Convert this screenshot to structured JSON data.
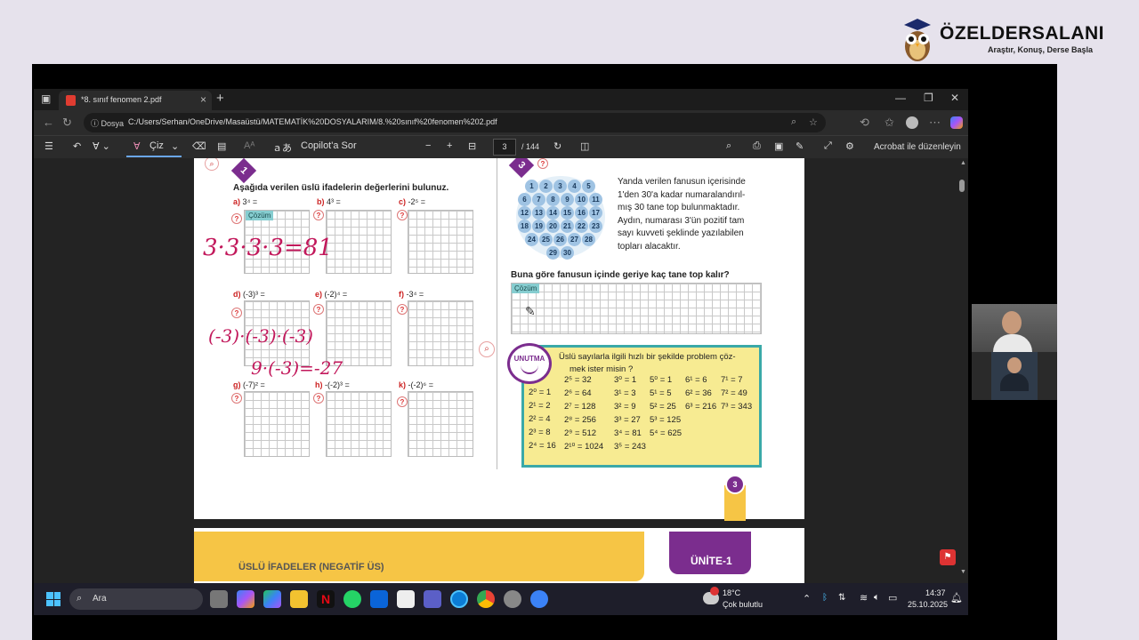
{
  "brand": {
    "name": "ÖZELDERSALANI",
    "tagline": "Araştır, Konuş, Derse Başla"
  },
  "browser": {
    "tab_title": "*8. sınıf fenomen 2.pdf",
    "url_prefix": "Dosya",
    "url": "C:/Users/Serhan/OneDrive/Masaüstü/MATEMATİK%20DOSYALARIM/8.%20sınıf%20fenomen%202.pdf"
  },
  "pdf_toolbar": {
    "draw_label": "Çiz",
    "copilot_label": "Copilot'a Sor",
    "page_current": "3",
    "page_total": "/ 144",
    "acrobat_label": "Acrobat ile düzenleyin"
  },
  "left": {
    "badge": "1",
    "heading": "Aşağıda verilen üslü ifadelerin değerlerini bulunuz.",
    "cozum": "Çözüm",
    "items": [
      {
        "label": "a)",
        "expr": "3⁴ ="
      },
      {
        "label": "b)",
        "expr": "4³ ="
      },
      {
        "label": "c)",
        "expr": "-2⁵ ="
      },
      {
        "label": "d)",
        "expr": "(-3)³ ="
      },
      {
        "label": "e)",
        "expr": "(-2)⁴ ="
      },
      {
        "label": "f)",
        "expr": "-3⁴ ="
      },
      {
        "label": "g)",
        "expr": "(-7)² ="
      },
      {
        "label": "h)",
        "expr": "-(-2)³ ="
      },
      {
        "label": "k)",
        "expr": "-(-2)⁶ ="
      }
    ],
    "handwriting": [
      "3·3·3·3=81",
      "(-3)·(-3)·(-3)",
      "9·(-3)=-27"
    ]
  },
  "right": {
    "badge": "3",
    "paragraph": [
      "Yanda verilen fanusun içerisinde",
      "1'den 30'a kadar numaralandırıl-",
      "mış 30 tane top bulunmaktadır.",
      "Aydın, numarası 3'ün pozitif tam",
      "sayı kuvveti şeklinde yazılabilen",
      "topları alacaktır."
    ],
    "balls": [
      "1",
      "2",
      "3",
      "4",
      "5",
      "6",
      "7",
      "8",
      "9",
      "10",
      "11",
      "12",
      "13",
      "14",
      "15",
      "16",
      "17",
      "18",
      "19",
      "20",
      "21",
      "22",
      "23",
      "24",
      "25",
      "26",
      "27",
      "28",
      "29",
      "30"
    ],
    "question": "Buna göre fanusun içinde geriye kaç tane top kalır?",
    "cozum": "Çözüm",
    "unutma": "UNUTMA",
    "unutma_text": [
      "Üslü sayılarla ilgili hızlı bir şekilde problem çöz-",
      "mek ister misin ?"
    ],
    "powers_col1": [
      "2⁰ = 1",
      "2¹ = 2",
      "2² = 4",
      "2³ = 8",
      "2⁴ = 16"
    ],
    "powers_col2": [
      "2⁵ = 32",
      "2⁶ = 64",
      "2⁷ = 128",
      "2⁸ = 256",
      "2⁹ = 512",
      "2¹⁰ = 1024"
    ],
    "powers_col3": [
      "3⁰ = 1",
      "3¹ = 3",
      "3² = 9",
      "3³ = 27",
      "3⁴ = 81",
      "3⁵ = 243"
    ],
    "powers_col4": [
      "5⁰ = 1",
      "5¹ = 5",
      "5² = 25",
      "5³ = 125",
      "5⁴ = 625"
    ],
    "powers_col5": [
      "6¹ = 6",
      "6² = 36",
      "6³ = 216"
    ],
    "powers_col6": [
      "7¹ = 7",
      "7² = 49",
      "7³ = 343"
    ],
    "page_number": "3"
  },
  "next_page": {
    "title": "ÜSLÜ İFADELER (NEGATİF ÜS)",
    "unit": "ÜNİTE-1"
  },
  "taskbar": {
    "search": "Ara",
    "weather_temp": "18°C",
    "weather_desc": "Çok bulutlu",
    "time": "14:37",
    "date": "25.10.2025"
  },
  "colors": {
    "accent_purple": "#7b2d8e",
    "accent_yellow": "#f6c545",
    "teal": "#3aa9a8",
    "handwriting": "#c2185b"
  }
}
